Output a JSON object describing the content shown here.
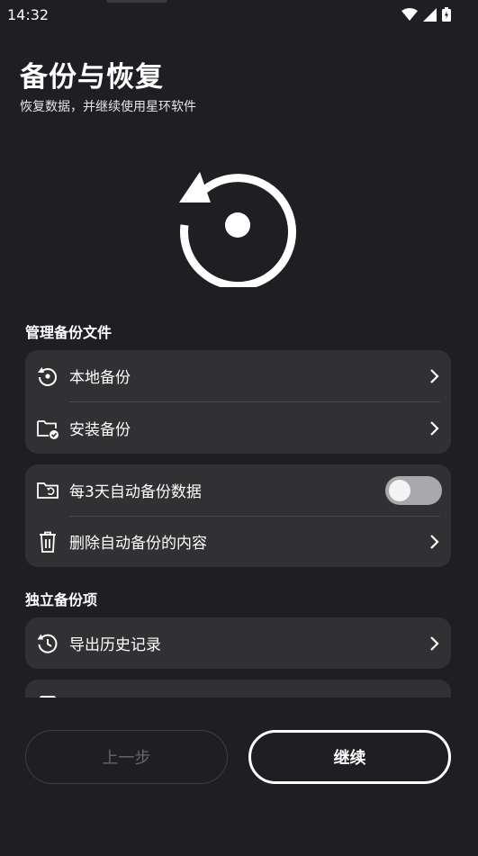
{
  "status_bar": {
    "time": "14:32",
    "icons": [
      "wifi-icon",
      "signal-icon",
      "battery-icon"
    ]
  },
  "header": {
    "title": "备份与恢复",
    "subtitle": "恢复数据，并继续使用星环软件"
  },
  "hero": {
    "icon": "restore-icon"
  },
  "sections": {
    "manage_title": "管理备份文件",
    "independent_title": "独立备份项"
  },
  "manage_card": {
    "items": [
      {
        "label": "本地备份",
        "icon": "local-backup-icon"
      },
      {
        "label": "安装备份",
        "icon": "install-backup-folder-icon"
      }
    ]
  },
  "auto_card": {
    "toggle_label": "每3天自动备份数据",
    "toggle_on": false,
    "delete_label": "删除自动备份的内容"
  },
  "independent_card": {
    "items": [
      {
        "label": "导出历史记录",
        "icon": "history-icon"
      }
    ]
  },
  "footer": {
    "prev_label": "上一步",
    "next_label": "继续"
  },
  "colors": {
    "background": "#1f1f23",
    "card": "#313134",
    "toggle_track": "#a9a9ad",
    "disabled_text": "#66666a"
  }
}
